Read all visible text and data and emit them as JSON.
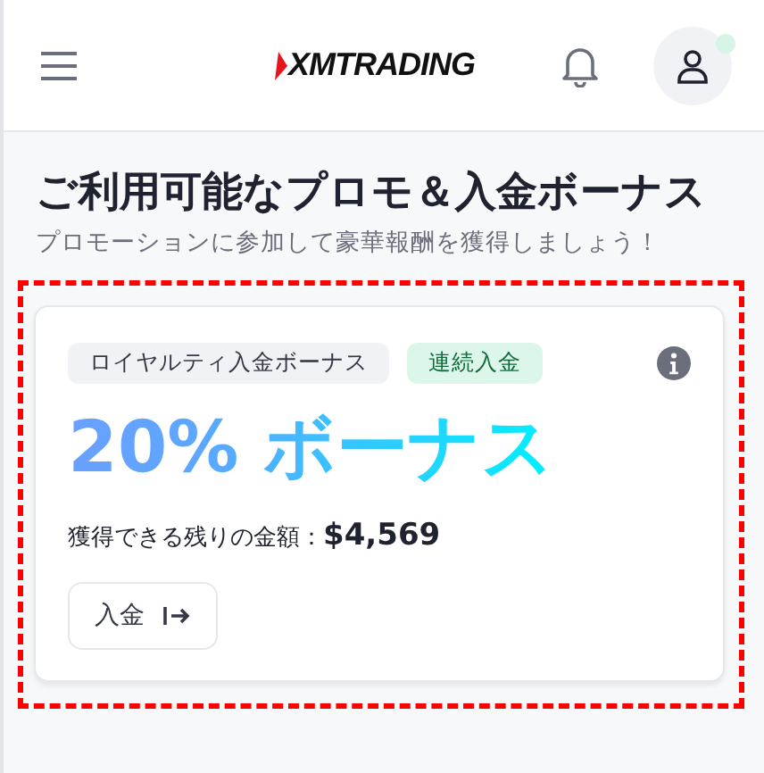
{
  "header": {
    "logo": "XMTRADING"
  },
  "page": {
    "title": "ご利用可能なプロモ＆入金ボーナス",
    "subtitle": "プロモーションに参加して豪華報酬を獲得しましょう！"
  },
  "promo_card": {
    "highlighted": true,
    "tags": [
      {
        "label": "ロイヤルティ入金ボーナス",
        "kind": "neutral"
      },
      {
        "label": "連続入金",
        "kind": "success"
      }
    ],
    "headline": "20% ボーナス",
    "remaining_label": "獲得できる残りの金額：",
    "remaining_amount": "$4,569",
    "button": "入金"
  }
}
